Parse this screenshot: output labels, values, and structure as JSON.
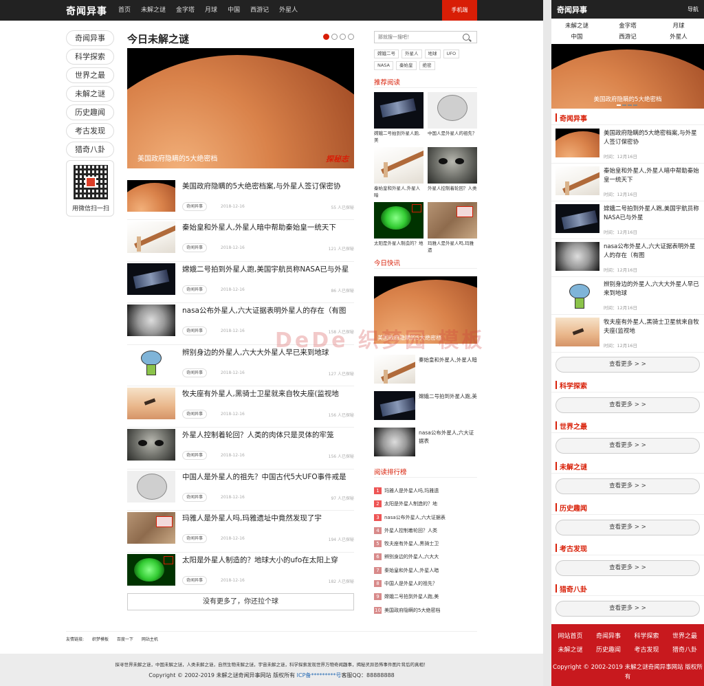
{
  "site": {
    "logo": "奇闻异事",
    "mobile_btn": "手机端"
  },
  "nav": [
    "首页",
    "未解之谜",
    "金字塔",
    "月球",
    "中国",
    "西游记",
    "外星人"
  ],
  "sidenav": [
    "奇闻异事",
    "科学探索",
    "世界之最",
    "未解之谜",
    "历史趣闻",
    "考古发现",
    "猎奇八卦"
  ],
  "qr": {
    "label": "用微信扫一扫"
  },
  "main": {
    "title": "今日未解之谜",
    "hero": {
      "caption": "美国政府隐瞒的5大绝密档",
      "watermark": "探秘志"
    },
    "articles": [
      {
        "title": "美国政府隐瞒的5大绝密档案,与外星人签订保密协",
        "tag": "奇闻异事",
        "date": "2018-12-16",
        "views": "55 人已探秘",
        "img": "planet"
      },
      {
        "title": "秦始皇和外星人,外星人暗中帮助秦始皇一统天下",
        "tag": "奇闻异事",
        "date": "2018-12-16",
        "views": "121 人已探秘",
        "img": "ruler"
      },
      {
        "title": "嫦娥二号拍到外星人跑,美国宇航员称NASA已与外星",
        "tag": "奇闻异事",
        "date": "2018-12-16",
        "views": "86 人已探秘",
        "img": "space"
      },
      {
        "title": "nasa公布外星人,六大证据表明外星人的存在（有图",
        "tag": "奇闻异事",
        "date": "2018-12-16",
        "views": "158 人已探秘",
        "img": "moon"
      },
      {
        "title": "辨别身边的外星人,六大大外星人早已来到地球",
        "tag": "奇闻异事",
        "date": "2018-12-16",
        "views": "127 人已探秘",
        "img": "cartoon"
      },
      {
        "title": "牧夫座有外星人,黑骑士卫星就来自牧夫座(监视地",
        "tag": "奇闻异事",
        "date": "2018-12-16",
        "views": "156 人已探秘",
        "img": "sky"
      },
      {
        "title": "外星人控制着轮回？人类的肉体只是灵体的牢笼",
        "tag": "奇闻异事",
        "date": "2018-12-16",
        "views": "156 人已探秘",
        "img": "alien"
      },
      {
        "title": "中国人是外星人的祖先？中国古代5大UFO事件戒是",
        "tag": "奇闻异事",
        "date": "2018-12-16",
        "views": "97 人已探秘",
        "img": "sketch"
      },
      {
        "title": "玛雅人是外星人吗,玛雅遗址中竟然发现了宇",
        "tag": "奇闻异事",
        "date": "2018-12-16",
        "views": "194 人已探秘",
        "img": "map"
      },
      {
        "title": "太阳是外星人制造的？地球大小的ufo在太阳上穿",
        "tag": "奇闻异事",
        "date": "2018-12-16",
        "views": "182 人已探秘",
        "img": "green"
      }
    ],
    "more": "没有更多了，你还拉个球"
  },
  "sidebar": {
    "search_placeholder": "那就搜一搜吧！",
    "tags": [
      "嫦娥二号",
      "外星人",
      "地球",
      "UFO",
      "NASA",
      "秦始皇",
      "绝密"
    ],
    "rec_title": "推荐阅读",
    "rec": [
      {
        "caption": "嫦娥二号拍到外星人跑,美",
        "img": "space"
      },
      {
        "caption": "中国人是外星人的祖先？",
        "img": "sketch"
      },
      {
        "caption": "秦始皇和外星人,外星人暗",
        "img": "ruler"
      },
      {
        "caption": "外星人控制着轮回？人类",
        "img": "alien"
      },
      {
        "caption": "太阳是外星人制造的？地",
        "img": "green"
      },
      {
        "caption": "玛雅人是外星人吗,玛雅遗",
        "img": "map"
      }
    ],
    "flash_title": "今日快讯",
    "flash_caption": "美国政府隐瞒的5大绝密档",
    "flash": [
      {
        "title": "秦始皇和外星人,外星人暗",
        "img": "ruler"
      },
      {
        "title": "嫦娥二号拍到外星人跑,美",
        "img": "space"
      },
      {
        "title": "nasa公布外星人,六大证据表",
        "img": "moon"
      }
    ],
    "rank_title": "阅读排行榜",
    "rank": [
      "玛雅人是外星人吗,玛雅遗",
      "太阳是外星人制造的？地",
      "nasa公布外星人,六大证据表",
      "外星人控制着轮回？人类",
      "牧夫座有外星人,黑骑士卫",
      "辨别身边的外星人,六大大",
      "秦始皇和外星人,外星人暗",
      "中国人是外星人的祖先？",
      "嫦娥二号拍到外星人跑,美",
      "美国政府隐瞒的5大绝密档"
    ]
  },
  "links": {
    "label": "友情链接:",
    "items": [
      "织梦模板",
      "百度一下",
      "网站主机"
    ]
  },
  "footer": {
    "desc": "探寻世界未解之谜，中国未解之谜，人类未解之谜，自然生物未解之谜，宇宙未解之谜，科学探索发现世界万物奇闻趣事，揭秘灵异恐怖事件图片背后的真相！",
    "copy": "Copyright © 2002-2019 未解之谜奇闻异事网站 版权所有",
    "icp": "ICP备*********号",
    "qq": "客服QQ：88888888"
  },
  "watermark": "DeDe 织梦园 模板",
  "mobile": {
    "logo": "奇闻异事",
    "nav_btn": "导航",
    "nav": [
      "未解之谜",
      "金字塔",
      "月球",
      "中国",
      "西游记",
      "外星人"
    ],
    "hero_caption": "美国政府隐瞒的5大绝密档",
    "section1": "奇闻异事",
    "items": [
      {
        "title": "美国政府隐瞒的5大绝密档案,与外星人签订保密协",
        "time": "时间：12月16日",
        "img": "planet"
      },
      {
        "title": "秦始皇和外星人,外星人暗中帮助秦始皇一统天下",
        "time": "时间：12月16日",
        "img": "ruler"
      },
      {
        "title": "嫦娥二号拍到外星人跑,美国宇航员称NASA已与外星",
        "time": "时间：12月16日",
        "img": "space"
      },
      {
        "title": "nasa公布外星人,六大证据表明外星人的存在（有图",
        "time": "时间：12月16日",
        "img": "moon"
      },
      {
        "title": "辨别身边的外星人,六大大外星人早已来到地球",
        "time": "时间：12月16日",
        "img": "cartoon"
      },
      {
        "title": "牧夫座有外星人,黑骑士卫星就来自牧夫座(监视地",
        "time": "时间：12月16日",
        "img": "sky"
      }
    ],
    "more": "查看更多 > >",
    "sections": [
      "科学探索",
      "世界之最",
      "未解之谜",
      "历史趣闻",
      "考古发现",
      "猎奇八卦"
    ],
    "footnav": [
      "网站首页",
      "奇闻异事",
      "科学探索",
      "世界之最",
      "未解之谜",
      "历史趣闻",
      "考古发现",
      "猎奇八卦"
    ],
    "copy": "Copyright © 2002-2019 未解之谜奇闻异事网站 版权所有"
  },
  "colors": {
    "accent": "#d81e06",
    "topbar": "#222222",
    "mobile_footer": "#c8191e"
  }
}
